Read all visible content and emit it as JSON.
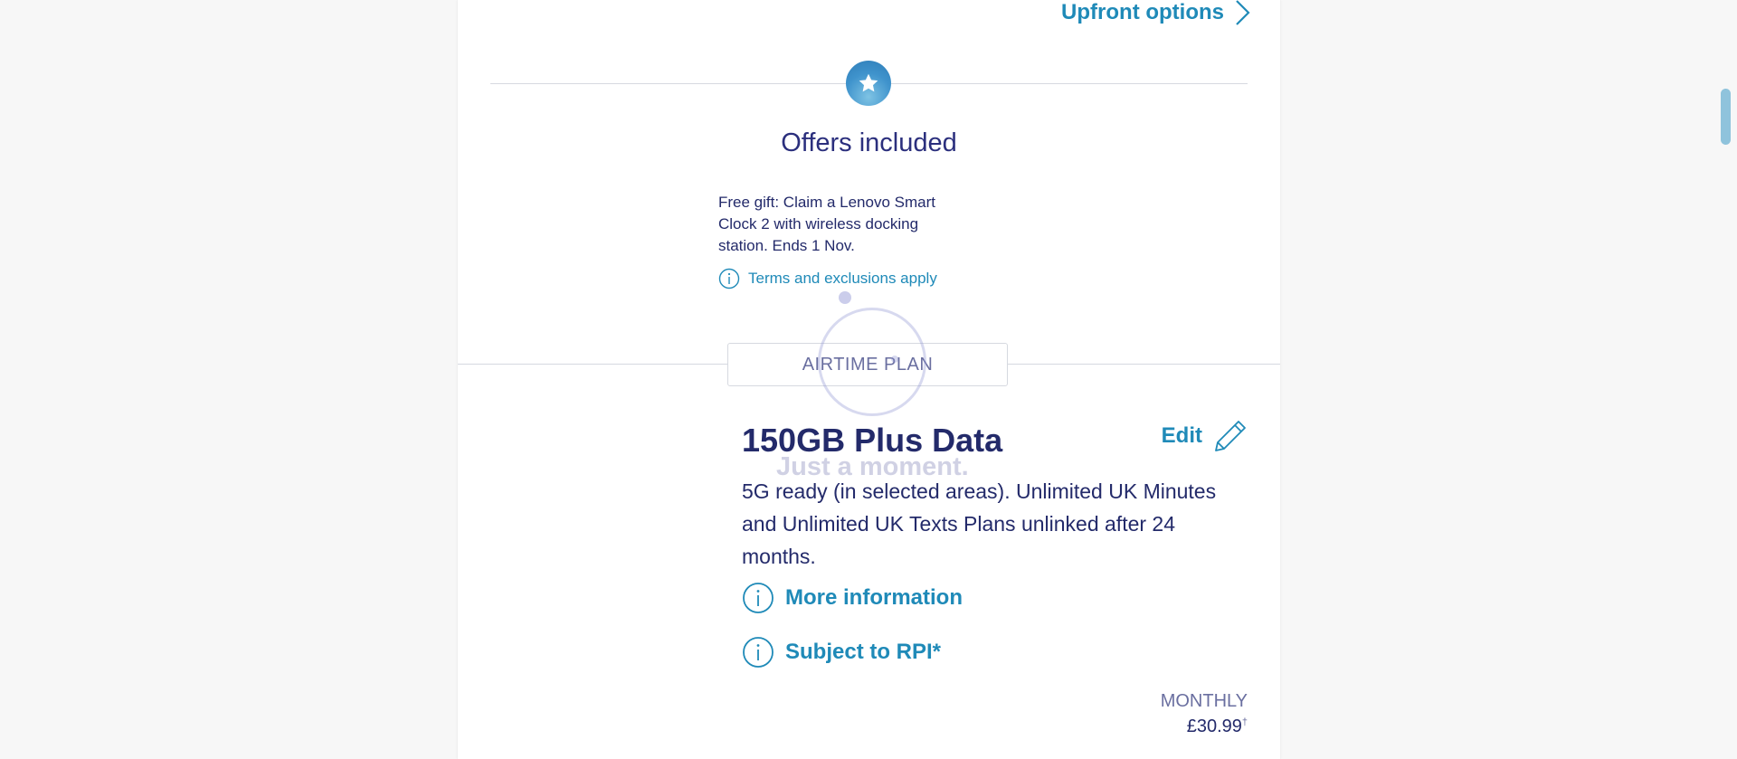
{
  "header": {
    "upfront_label": "Upfront options"
  },
  "offers": {
    "title": "Offers included",
    "description": "Free gift: Claim a Lenovo Smart Clock 2 with wireless docking station. Ends 1 Nov.",
    "terms_label": "Terms and exclusions apply"
  },
  "plan": {
    "section_label": "AIRTIME PLAN",
    "name": "150GB Plus Data",
    "edit_label": "Edit",
    "description": "5G ready (in selected areas). Unlimited UK Minutes and Unlimited UK Texts Plans unlinked after 24 months.",
    "more_info_label": "More information",
    "rpi_label": "Subject to RPI*",
    "monthly_label": "MONTHLY",
    "monthly_price": "£30.99",
    "price_marker": "†"
  },
  "loader": {
    "text": "Just a moment."
  },
  "colors": {
    "accent": "#1f8ab8",
    "text_dark": "#232a6a",
    "muted": "#6a6fa0"
  },
  "icons": [
    "chevron-right-icon",
    "star-icon",
    "info-icon",
    "pencil-icon"
  ]
}
